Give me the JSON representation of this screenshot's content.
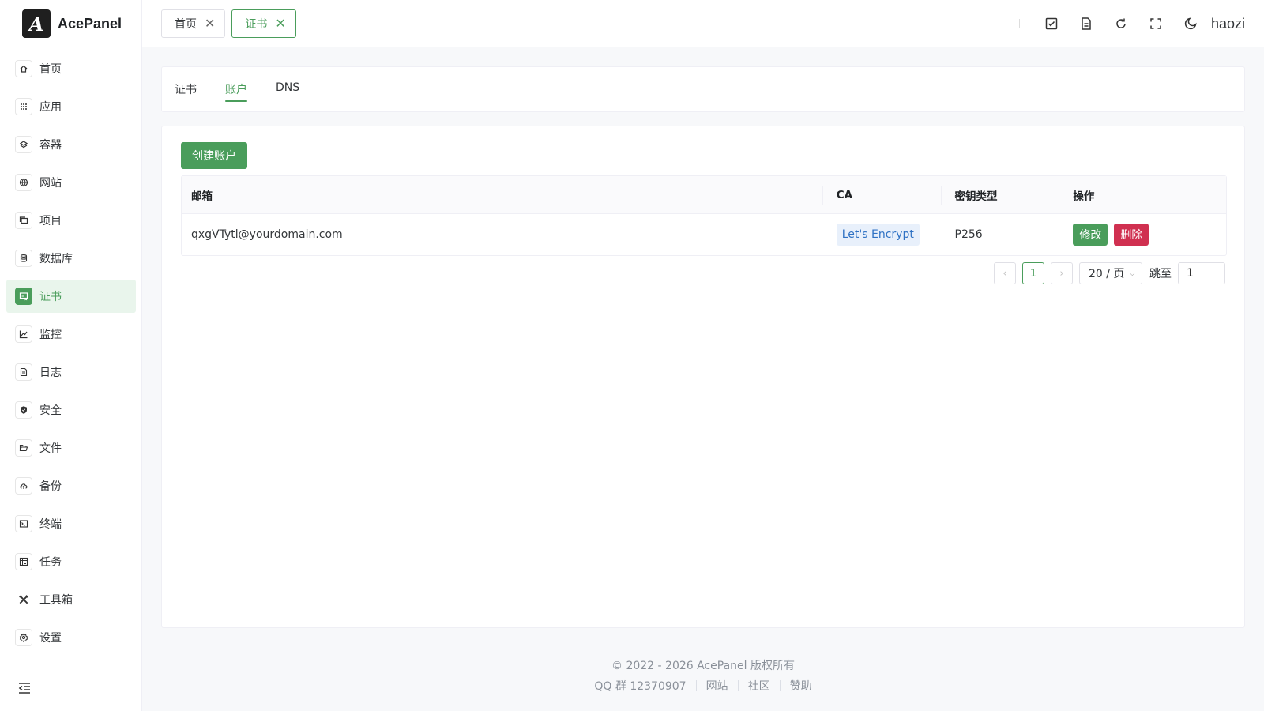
{
  "brand": {
    "logo_letter": "A",
    "name": "AcePanel"
  },
  "sidebar": {
    "items": [
      {
        "label": "首页",
        "icon": "home-icon"
      },
      {
        "label": "应用",
        "icon": "grid-icon"
      },
      {
        "label": "容器",
        "icon": "layers-icon"
      },
      {
        "label": "网站",
        "icon": "globe-icon"
      },
      {
        "label": "项目",
        "icon": "folder-stack-icon"
      },
      {
        "label": "数据库",
        "icon": "database-icon"
      },
      {
        "label": "证书",
        "icon": "certificate-icon",
        "active": true
      },
      {
        "label": "监控",
        "icon": "chart-line-icon"
      },
      {
        "label": "日志",
        "icon": "document-icon"
      },
      {
        "label": "安全",
        "icon": "shield-icon"
      },
      {
        "label": "文件",
        "icon": "folder-open-icon"
      },
      {
        "label": "备份",
        "icon": "cloud-upload-icon"
      },
      {
        "label": "终端",
        "icon": "terminal-icon"
      },
      {
        "label": "任务",
        "icon": "task-icon"
      },
      {
        "label": "工具箱",
        "icon": "tools-icon"
      },
      {
        "label": "设置",
        "icon": "gear-icon"
      }
    ]
  },
  "topbar": {
    "tabs": [
      {
        "label": "首页",
        "active": false
      },
      {
        "label": "证书",
        "active": true
      }
    ],
    "tools": [
      "checkbox-icon",
      "document-icon",
      "refresh-icon",
      "fullscreen-icon",
      "theme-moon-icon"
    ],
    "username": "haozi"
  },
  "content": {
    "sub_tabs": [
      {
        "label": "证书",
        "active": false
      },
      {
        "label": "账户",
        "active": true
      },
      {
        "label": "DNS",
        "active": false
      }
    ],
    "create_button": "创建账户",
    "table": {
      "headers": [
        "邮箱",
        "CA",
        "密钥类型",
        "操作"
      ],
      "rows": [
        {
          "email": "qxgVTytl@yourdomain.com",
          "ca": "Let's Encrypt",
          "key_type": "P256",
          "edit": "修改",
          "delete": "删除"
        }
      ]
    },
    "pagination": {
      "current_page": "1",
      "page_size": "20 / 页",
      "jump_label": "跳至",
      "jump_value": "1"
    }
  },
  "footer": {
    "copyright": "© 2022 - 2026 AcePanel 版权所有",
    "qq": "QQ 群 12370907",
    "links": [
      "网站",
      "社区",
      "赞助"
    ]
  },
  "colors": {
    "primary": "#4a9d5b",
    "danger": "#d03050",
    "tag_blue": "#2f72c4"
  }
}
